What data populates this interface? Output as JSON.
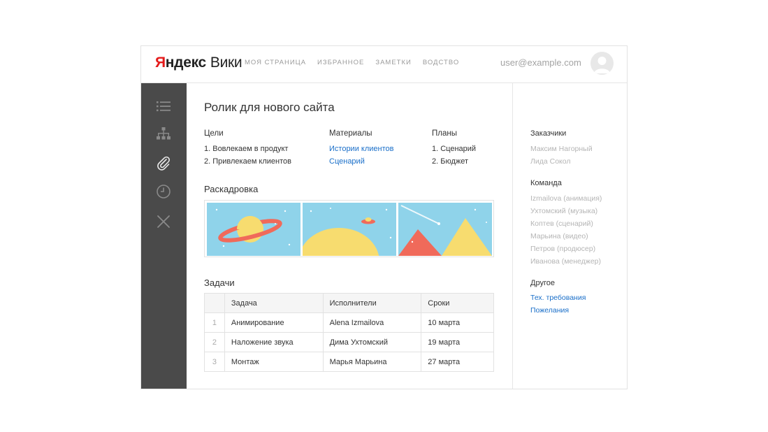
{
  "app": {
    "logo_y": "Я",
    "logo_rest": "ндекс",
    "logo_wiki": "Вики"
  },
  "nav": [
    "Моя страница",
    "Избранное",
    "Заметки",
    "водство"
  ],
  "user": {
    "email": "user@example.com"
  },
  "sidebar_icons": [
    "list-icon",
    "sitemap-icon",
    "paperclip-icon",
    "clock-icon",
    "close-icon"
  ],
  "page": {
    "title": "Ролик для нового сайта",
    "goals": {
      "heading": "Цели",
      "items": [
        "1. Вовлекаем в продукт",
        "2. Привлекаем клиентов"
      ]
    },
    "materials": {
      "heading": "Материалы",
      "items": [
        "Истории клиентов",
        "Сценарий"
      ]
    },
    "plans": {
      "heading": "Планы",
      "items": [
        "1. Сценарий",
        "2. Бюджет"
      ]
    },
    "storyboard_title": "Раскадровка",
    "tasks_title": "Задачи",
    "tasks": {
      "headers": [
        "",
        "Задача",
        "Исполнители",
        "Сроки"
      ],
      "rows": [
        [
          "1",
          "Анимирование",
          "Alena Izmailova",
          "10 марта"
        ],
        [
          "2",
          "Наложение звука",
          "Дима Ухтомский",
          "19 марта"
        ],
        [
          "3",
          "Монтаж",
          "Марья Марьина",
          "27 марта"
        ]
      ]
    }
  },
  "right_panel": {
    "clients": {
      "heading": "Заказчики",
      "items": [
        "Максим Нагорный",
        "Лида Сокол"
      ]
    },
    "team": {
      "heading": "Команда",
      "items": [
        "Izmailova (анимация)",
        "Ухтомский (музыка)",
        "Коптев (сценарий)",
        "Марьина (видео)",
        "Петров (продюсер)",
        "Иванова (менеджер)"
      ]
    },
    "other": {
      "heading": "Другое",
      "items": [
        "Тех. требования",
        "Пожелания"
      ]
    }
  },
  "colors": {
    "sidebar": "#4a4a4a",
    "link": "#1a6fc9",
    "sky": "#8fd3ea",
    "sand": "#f7dc6f",
    "coral": "#f06a5a"
  }
}
